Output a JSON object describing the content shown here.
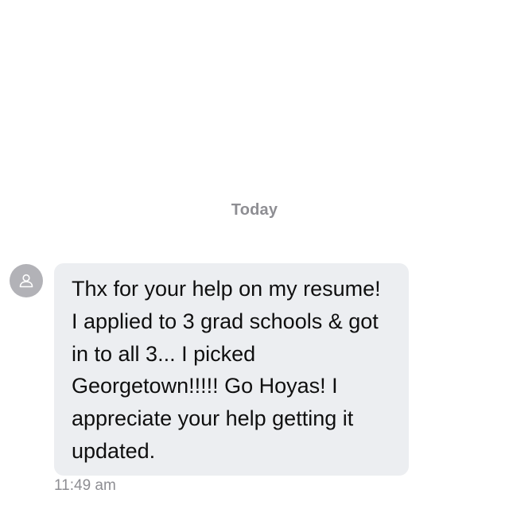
{
  "conversation": {
    "date_divider": "Today"
  },
  "message": {
    "sender_icon": "person-icon",
    "lines": [
      "Thx for your help on my resume!",
      "I applied to 3 grad schools & got",
      "in to all 3... I picked",
      "Georgetown!!!!! Go Hoyas! I",
      "appreciate your help getting it",
      "updated."
    ],
    "time": "11:49 am"
  },
  "colors": {
    "bubble": "#eceef1",
    "avatar": "#b2b2b7",
    "meta_text": "#8e8e93"
  }
}
